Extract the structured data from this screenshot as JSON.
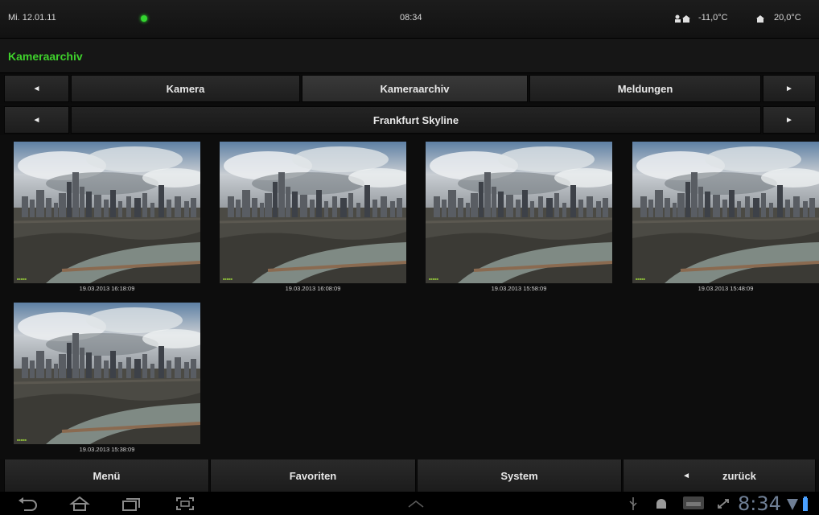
{
  "status": {
    "date": "Mi. 12.01.11",
    "time": "08:34",
    "outdoor_temp": "-11,0°C",
    "indoor_temp": "20,0°C",
    "online_color": "#33d62f"
  },
  "page": {
    "title": "Kameraarchiv",
    "accent": "#3fd12c"
  },
  "tabs": {
    "prev_icon": "triangle-left-icon",
    "next_icon": "triangle-right-icon",
    "items": [
      {
        "label": "Kamera"
      },
      {
        "label": "Kameraarchiv",
        "active": true
      },
      {
        "label": "Meldungen"
      }
    ]
  },
  "camera_selector": {
    "label": "Frankfurt Skyline"
  },
  "archive": {
    "images": [
      {
        "caption": "19.03.2013 16:18:09"
      },
      {
        "caption": "19.03.2013 16:08:09"
      },
      {
        "caption": "19.03.2013 15:58:09"
      },
      {
        "caption": "19.03.2013 15:48:09"
      },
      {
        "caption": "19.03.2013 15:38:09"
      }
    ]
  },
  "menu": {
    "menu_label": "Menü",
    "favorites_label": "Favoriten",
    "system_label": "System",
    "back_label": "zurück"
  },
  "android": {
    "clock": "8:34"
  }
}
